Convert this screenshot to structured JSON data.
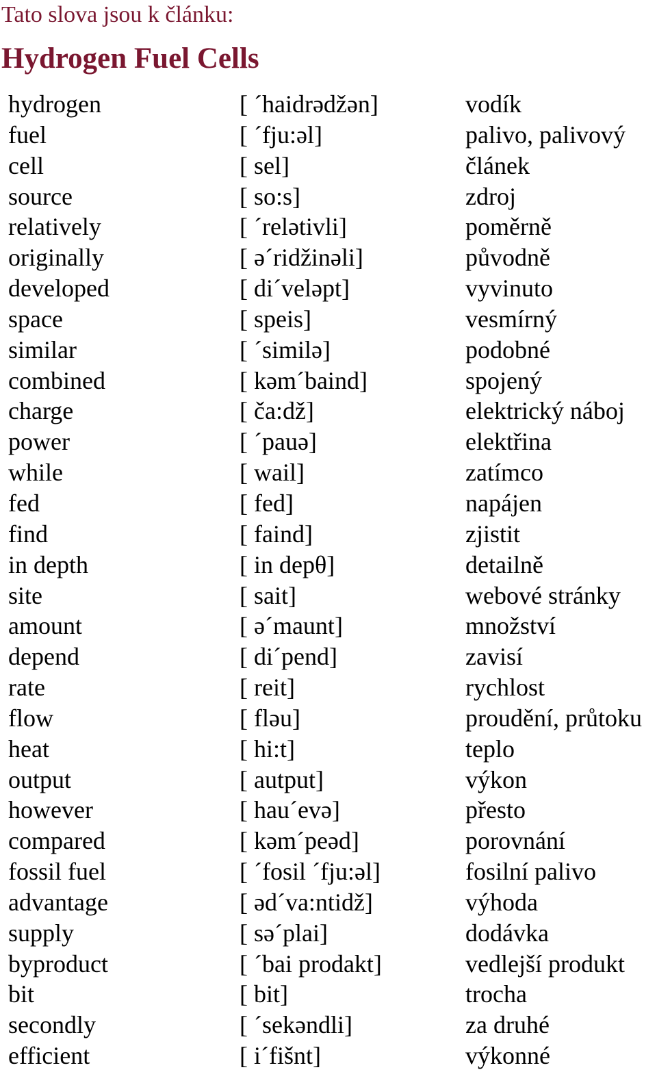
{
  "header": {
    "subtitle": "Tato slova jsou k článku:",
    "title": "Hydrogen Fuel Cells"
  },
  "colors": {
    "heading": "#7a1730",
    "text": "#000000"
  },
  "vocabulary": [
    {
      "english": "hydrogen",
      "phonetic": "[ ´haidrədžən]",
      "czech": "vodík"
    },
    {
      "english": "fuel",
      "phonetic": "[ ´fju:əl]",
      "czech": "palivo, palivový"
    },
    {
      "english": "cell",
      "phonetic": "[ sel]",
      "czech": "článek"
    },
    {
      "english": "source",
      "phonetic": "[ so:s]",
      "czech": "zdroj"
    },
    {
      "english": "relatively",
      "phonetic": "[ ´relətivli]",
      "czech": "poměrně"
    },
    {
      "english": "originally",
      "phonetic": "[ ə´ridžinəli]",
      "czech": "původně"
    },
    {
      "english": "developed",
      "phonetic": "[ di´veləpt]",
      "czech": "vyvinuto"
    },
    {
      "english": "space",
      "phonetic": "[ speis]",
      "czech": "vesmírný"
    },
    {
      "english": "similar",
      "phonetic": "[ ´similə]",
      "czech": "podobné"
    },
    {
      "english": "combined",
      "phonetic": "[ kəm´baind]",
      "czech": "spojený"
    },
    {
      "english": "charge",
      "phonetic": "[ ča:dž]",
      "czech": "elektrický náboj"
    },
    {
      "english": "power",
      "phonetic": "[ ´pauə]",
      "czech": "elektřina"
    },
    {
      "english": "while",
      "phonetic": "[ wail]",
      "czech": "zatímco"
    },
    {
      "english": "fed",
      "phonetic": "[ fed]",
      "czech": "napájen"
    },
    {
      "english": "find",
      "phonetic": "[ faind]",
      "czech": "zjistit"
    },
    {
      "english": "in depth",
      "phonetic": "[ in depθ]",
      "czech": "detailně"
    },
    {
      "english": "site",
      "phonetic": "[ sait]",
      "czech": "webové stránky"
    },
    {
      "english": "amount",
      "phonetic": "[ ə´maunt]",
      "czech": "množství"
    },
    {
      "english": "depend",
      "phonetic": "[ di´pend]",
      "czech": "zavisí"
    },
    {
      "english": "rate",
      "phonetic": "[ reit]",
      "czech": "rychlost"
    },
    {
      "english": "flow",
      "phonetic": "[ fləu]",
      "czech": "proudění, průtoku"
    },
    {
      "english": "heat",
      "phonetic": "[ hi:t]",
      "czech": "teplo"
    },
    {
      "english": "output",
      "phonetic": "[ autput]",
      "czech": "výkon"
    },
    {
      "english": "however",
      "phonetic": "[ hau´evə]",
      "czech": "přesto"
    },
    {
      "english": "compared",
      "phonetic": "[ kəm´peəd]",
      "czech": "porovnání"
    },
    {
      "english": "fossil fuel",
      "phonetic": "[ ´fosil ´fju:əl]",
      "czech": "fosilní palivo"
    },
    {
      "english": "advantage",
      "phonetic": "[ əd´va:ntidž]",
      "czech": "výhoda"
    },
    {
      "english": "supply",
      "phonetic": "[ sə´plai]",
      "czech": "dodávka"
    },
    {
      "english": "byproduct",
      "phonetic": "[ ´bai prodakt]",
      "czech": "vedlejší produkt"
    },
    {
      "english": "bit",
      "phonetic": "[ bit]",
      "czech": "trocha"
    },
    {
      "english": "secondly",
      "phonetic": "[ ´sekəndli]",
      "czech": "za druhé"
    },
    {
      "english": "efficient",
      "phonetic": "[ i´fišnt]",
      "czech": "výkonné"
    }
  ]
}
